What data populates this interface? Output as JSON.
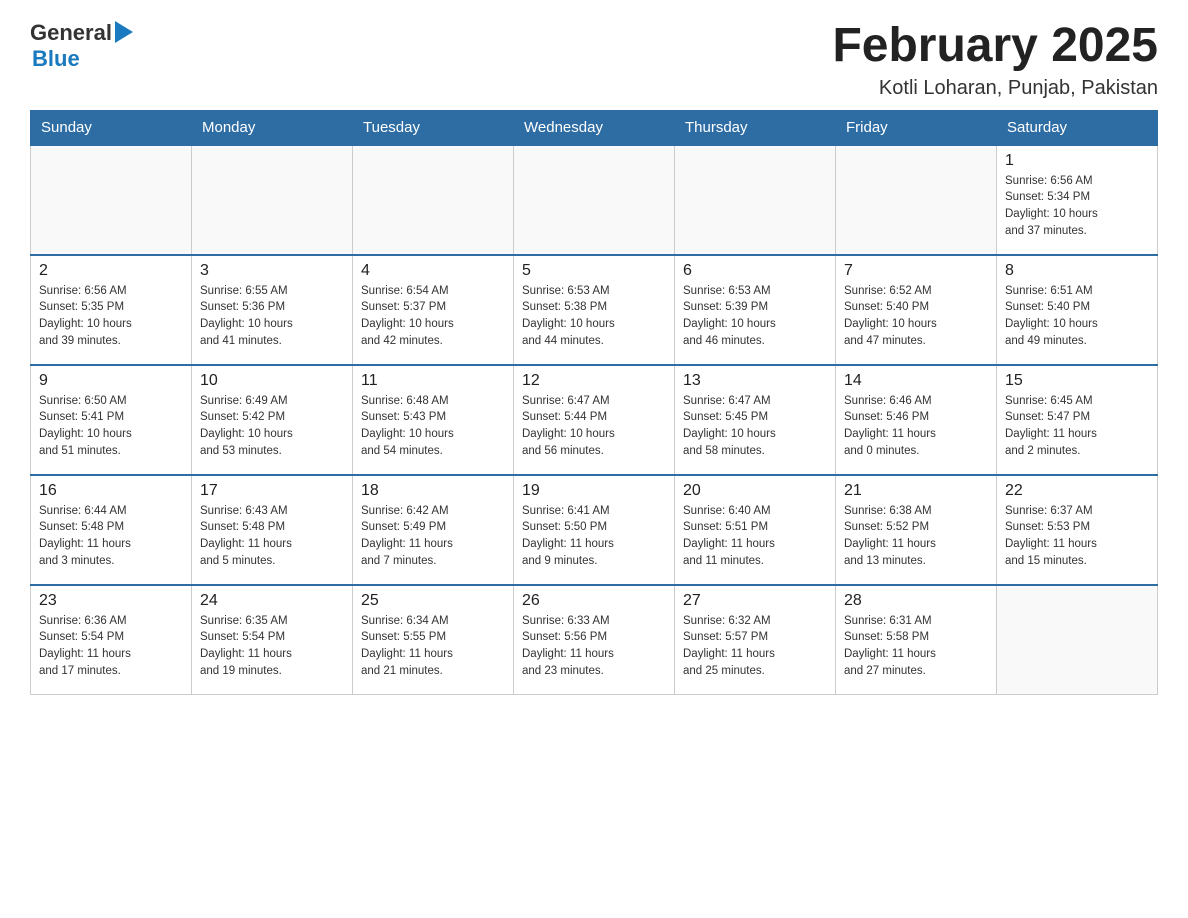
{
  "header": {
    "logo": {
      "general": "General",
      "arrow": "▶",
      "blue": "Blue"
    },
    "title": "February 2025",
    "subtitle": "Kotli Loharan, Punjab, Pakistan"
  },
  "days_of_week": [
    "Sunday",
    "Monday",
    "Tuesday",
    "Wednesday",
    "Thursday",
    "Friday",
    "Saturday"
  ],
  "weeks": [
    {
      "days": [
        {
          "number": "",
          "info": ""
        },
        {
          "number": "",
          "info": ""
        },
        {
          "number": "",
          "info": ""
        },
        {
          "number": "",
          "info": ""
        },
        {
          "number": "",
          "info": ""
        },
        {
          "number": "",
          "info": ""
        },
        {
          "number": "1",
          "info": "Sunrise: 6:56 AM\nSunset: 5:34 PM\nDaylight: 10 hours\nand 37 minutes."
        }
      ]
    },
    {
      "days": [
        {
          "number": "2",
          "info": "Sunrise: 6:56 AM\nSunset: 5:35 PM\nDaylight: 10 hours\nand 39 minutes."
        },
        {
          "number": "3",
          "info": "Sunrise: 6:55 AM\nSunset: 5:36 PM\nDaylight: 10 hours\nand 41 minutes."
        },
        {
          "number": "4",
          "info": "Sunrise: 6:54 AM\nSunset: 5:37 PM\nDaylight: 10 hours\nand 42 minutes."
        },
        {
          "number": "5",
          "info": "Sunrise: 6:53 AM\nSunset: 5:38 PM\nDaylight: 10 hours\nand 44 minutes."
        },
        {
          "number": "6",
          "info": "Sunrise: 6:53 AM\nSunset: 5:39 PM\nDaylight: 10 hours\nand 46 minutes."
        },
        {
          "number": "7",
          "info": "Sunrise: 6:52 AM\nSunset: 5:40 PM\nDaylight: 10 hours\nand 47 minutes."
        },
        {
          "number": "8",
          "info": "Sunrise: 6:51 AM\nSunset: 5:40 PM\nDaylight: 10 hours\nand 49 minutes."
        }
      ]
    },
    {
      "days": [
        {
          "number": "9",
          "info": "Sunrise: 6:50 AM\nSunset: 5:41 PM\nDaylight: 10 hours\nand 51 minutes."
        },
        {
          "number": "10",
          "info": "Sunrise: 6:49 AM\nSunset: 5:42 PM\nDaylight: 10 hours\nand 53 minutes."
        },
        {
          "number": "11",
          "info": "Sunrise: 6:48 AM\nSunset: 5:43 PM\nDaylight: 10 hours\nand 54 minutes."
        },
        {
          "number": "12",
          "info": "Sunrise: 6:47 AM\nSunset: 5:44 PM\nDaylight: 10 hours\nand 56 minutes."
        },
        {
          "number": "13",
          "info": "Sunrise: 6:47 AM\nSunset: 5:45 PM\nDaylight: 10 hours\nand 58 minutes."
        },
        {
          "number": "14",
          "info": "Sunrise: 6:46 AM\nSunset: 5:46 PM\nDaylight: 11 hours\nand 0 minutes."
        },
        {
          "number": "15",
          "info": "Sunrise: 6:45 AM\nSunset: 5:47 PM\nDaylight: 11 hours\nand 2 minutes."
        }
      ]
    },
    {
      "days": [
        {
          "number": "16",
          "info": "Sunrise: 6:44 AM\nSunset: 5:48 PM\nDaylight: 11 hours\nand 3 minutes."
        },
        {
          "number": "17",
          "info": "Sunrise: 6:43 AM\nSunset: 5:48 PM\nDaylight: 11 hours\nand 5 minutes."
        },
        {
          "number": "18",
          "info": "Sunrise: 6:42 AM\nSunset: 5:49 PM\nDaylight: 11 hours\nand 7 minutes."
        },
        {
          "number": "19",
          "info": "Sunrise: 6:41 AM\nSunset: 5:50 PM\nDaylight: 11 hours\nand 9 minutes."
        },
        {
          "number": "20",
          "info": "Sunrise: 6:40 AM\nSunset: 5:51 PM\nDaylight: 11 hours\nand 11 minutes."
        },
        {
          "number": "21",
          "info": "Sunrise: 6:38 AM\nSunset: 5:52 PM\nDaylight: 11 hours\nand 13 minutes."
        },
        {
          "number": "22",
          "info": "Sunrise: 6:37 AM\nSunset: 5:53 PM\nDaylight: 11 hours\nand 15 minutes."
        }
      ]
    },
    {
      "days": [
        {
          "number": "23",
          "info": "Sunrise: 6:36 AM\nSunset: 5:54 PM\nDaylight: 11 hours\nand 17 minutes."
        },
        {
          "number": "24",
          "info": "Sunrise: 6:35 AM\nSunset: 5:54 PM\nDaylight: 11 hours\nand 19 minutes."
        },
        {
          "number": "25",
          "info": "Sunrise: 6:34 AM\nSunset: 5:55 PM\nDaylight: 11 hours\nand 21 minutes."
        },
        {
          "number": "26",
          "info": "Sunrise: 6:33 AM\nSunset: 5:56 PM\nDaylight: 11 hours\nand 23 minutes."
        },
        {
          "number": "27",
          "info": "Sunrise: 6:32 AM\nSunset: 5:57 PM\nDaylight: 11 hours\nand 25 minutes."
        },
        {
          "number": "28",
          "info": "Sunrise: 6:31 AM\nSunset: 5:58 PM\nDaylight: 11 hours\nand 27 minutes."
        },
        {
          "number": "",
          "info": ""
        }
      ]
    }
  ]
}
